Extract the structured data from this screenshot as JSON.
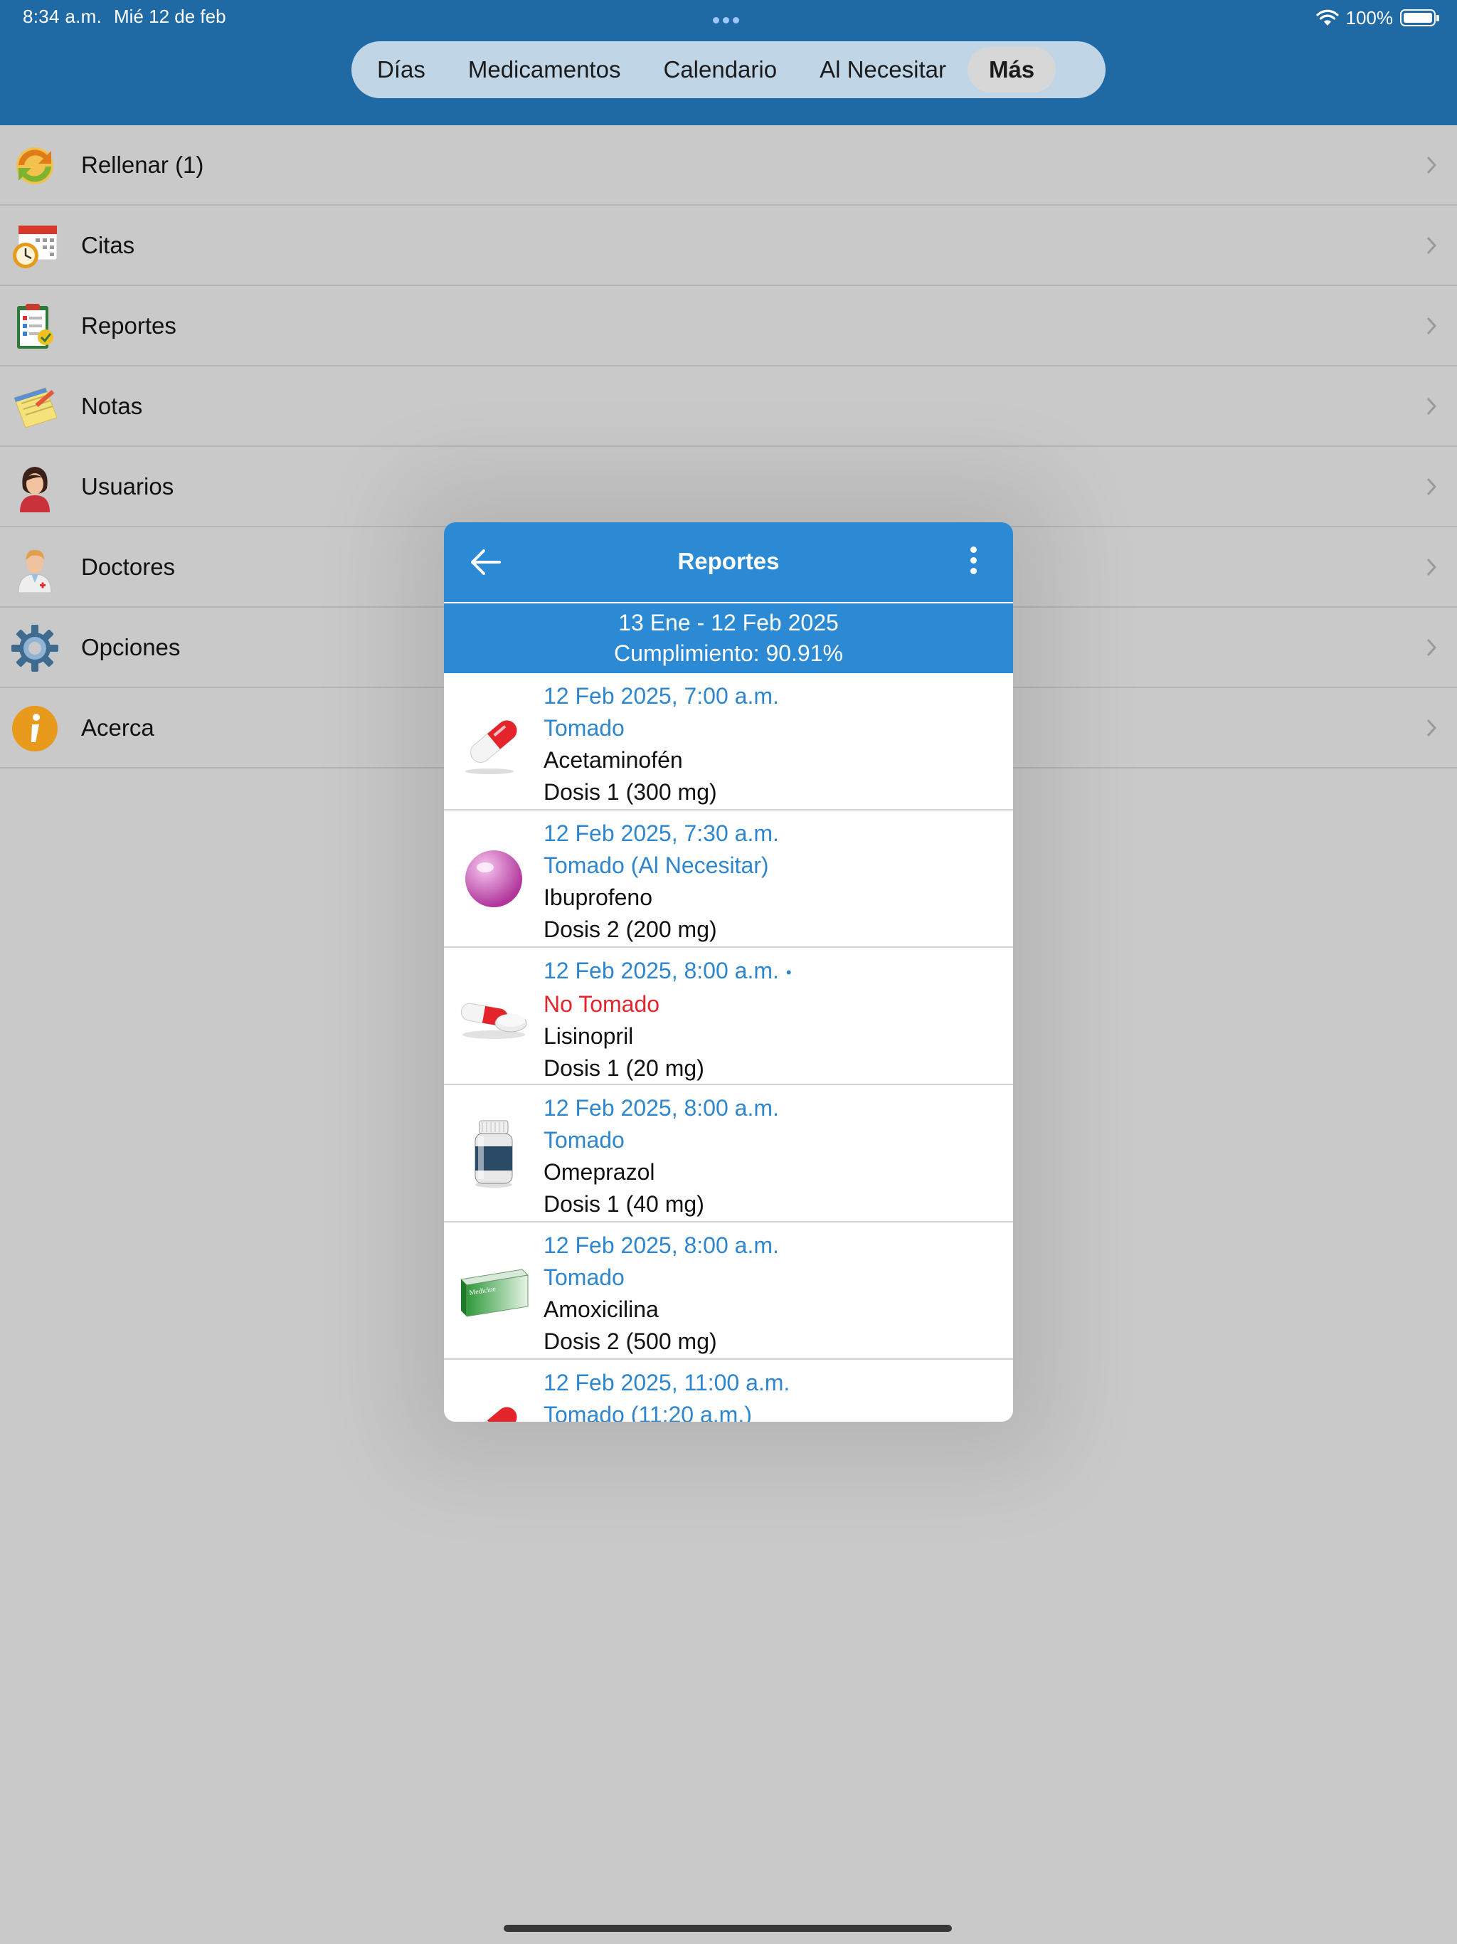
{
  "status_bar": {
    "time": "8:34 a.m.",
    "date": "Mié 12 de feb",
    "battery": "100%"
  },
  "segmented": {
    "items": [
      {
        "label": "Días",
        "active": false
      },
      {
        "label": "Medicamentos",
        "active": false
      },
      {
        "label": "Calendario",
        "active": false
      },
      {
        "label": "Al Necesitar",
        "active": false
      },
      {
        "label": "Más",
        "active": true
      }
    ]
  },
  "menu": {
    "items": [
      {
        "label": "Rellenar (1)",
        "icon": "refill-icon"
      },
      {
        "label": "Citas",
        "icon": "appointments-icon"
      },
      {
        "label": "Reportes",
        "icon": "reports-clipboard-icon"
      },
      {
        "label": "Notas",
        "icon": "notes-icon"
      },
      {
        "label": "Usuarios",
        "icon": "user-avatar-icon"
      },
      {
        "label": "Doctores",
        "icon": "doctor-icon"
      },
      {
        "label": "Opciones",
        "icon": "gear-icon"
      },
      {
        "label": "Acerca",
        "icon": "info-icon"
      }
    ]
  },
  "modal": {
    "title": "Reportes",
    "range": "13 Ene - 12 Feb 2025",
    "compliance": "Cumplimiento: 90.91%",
    "entries": [
      {
        "datetime": "12 Feb 2025, 7:00 a.m.",
        "status": "Tomado",
        "status_color": "#2e86cf",
        "name": "Acetaminofén",
        "dose": "Dosis 1 (300 mg)",
        "icon": "red-capsule-icon"
      },
      {
        "datetime": "12 Feb 2025, 7:30 a.m.",
        "status": "Tomado (Al Necesitar)",
        "status_color": "#2e86cf",
        "name": "Ibuprofeno",
        "dose": "Dosis 2 (200 mg)",
        "icon": "pink-pill-icon"
      },
      {
        "datetime": "12 Feb 2025, 8:00 a.m.",
        "note_marker": "•",
        "status": "No Tomado",
        "status_color": "#e2262c",
        "name": "Lisinopril",
        "dose": "Dosis 1 (20 mg)",
        "icon": "capsule-and-tablet-icon"
      },
      {
        "datetime": "12 Feb 2025, 8:00 a.m.",
        "status": "Tomado",
        "status_color": "#2e86cf",
        "name": "Omeprazol",
        "dose": "Dosis 1 (40 mg)",
        "icon": "pill-bottle-icon"
      },
      {
        "datetime": "12 Feb 2025, 8:00 a.m.",
        "status": "Tomado",
        "status_color": "#2e86cf",
        "name": "Amoxicilina",
        "dose": "Dosis 2 (500 mg)",
        "icon": "medicine-box-icon",
        "box_text": "Medicine"
      },
      {
        "datetime": "12 Feb 2025, 11:00 a.m.",
        "status": "Tomado (11:20 a.m.)",
        "status_color": "#2e86cf",
        "name": "",
        "dose": "",
        "icon": "red-capsule-icon"
      }
    ]
  },
  "colors": {
    "header_blue": "#1f6aa5",
    "modal_blue": "#2c8ad4",
    "link_blue": "#2e86cf",
    "missed_red": "#e2262c"
  }
}
